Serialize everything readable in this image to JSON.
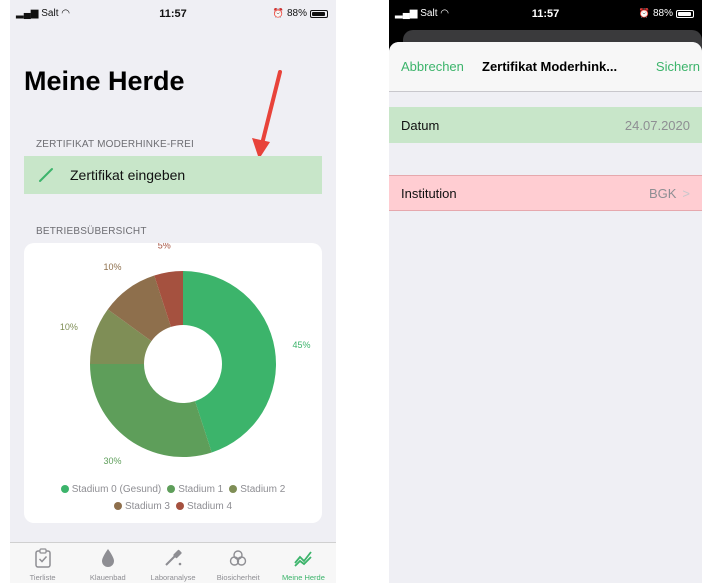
{
  "left_screen": {
    "status": {
      "carrier": "Salt",
      "time": "11:57",
      "battery": "88%"
    },
    "title": "Meine Herde",
    "cert_section_label": "ZERTIFIKAT MODERHINKE-FREI",
    "cert_button_label": "Zertifikat eingeben",
    "overview_section_label": "BETRIEBSÜBERSICHT",
    "tabs": [
      {
        "label": "Tierliste",
        "icon": "clipboard-check-icon"
      },
      {
        "label": "Klauenbad",
        "icon": "drop-icon"
      },
      {
        "label": "Laboranalyse",
        "icon": "pipette-icon"
      },
      {
        "label": "Biosicherheit",
        "icon": "biohazard-icon"
      },
      {
        "label": "Meine Herde",
        "icon": "trend-icon",
        "active": true
      }
    ]
  },
  "chart_data": {
    "type": "pie",
    "variant": "donut",
    "title": "",
    "slices": [
      {
        "label": "Stadium 0 (Gesund)",
        "value": 45,
        "value_label": "45%",
        "color": "#3cb46b"
      },
      {
        "label": "Stadium 1",
        "value": 30,
        "value_label": "30%",
        "color": "#5e9e5a"
      },
      {
        "label": "Stadium 2",
        "value": 10,
        "value_label": "10%",
        "color": "#7f8e56"
      },
      {
        "label": "Stadium 3",
        "value": 10,
        "value_label": "10%",
        "color": "#8e6f4c"
      },
      {
        "label": "Stadium 4",
        "value": 5,
        "value_label": "5%",
        "color": "#a5513f"
      }
    ],
    "legend_position": "bottom"
  },
  "right_screen": {
    "status": {
      "carrier": "Salt",
      "time": "11:57",
      "battery": "88%"
    },
    "cancel_label": "Abbrechen",
    "title": "Zertifikat Moderhink...",
    "save_label": "Sichern",
    "date_label": "Datum",
    "date_value": "24.07.2020",
    "institution_label": "Institution",
    "institution_value": "BGK",
    "institution_chevron": ">"
  },
  "colors": {
    "accent_green": "#3cb46b",
    "row_green": "#c8e6c9",
    "row_red": "#ffcdd2",
    "annotation_arrow": "#e8433a"
  }
}
